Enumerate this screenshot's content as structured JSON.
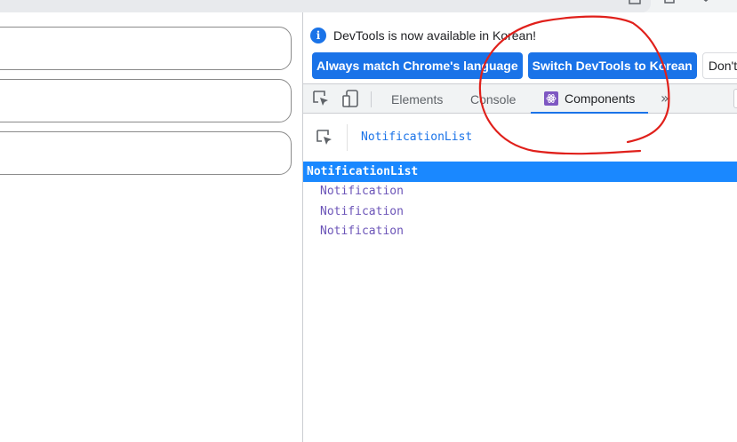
{
  "devtools": {
    "infobar": {
      "message": "DevTools is now available in Korean!",
      "buttons": {
        "match_language": "Always match Chrome's language",
        "switch_language": "Switch DevTools to Korean",
        "dont_show": "Don't"
      }
    },
    "tabs": [
      {
        "label": "Elements",
        "active": false
      },
      {
        "label": "Console",
        "active": false
      },
      {
        "label": "Components",
        "active": true
      }
    ],
    "more_tabs_symbol": "»",
    "components": {
      "breadcrumb": "NotificationList",
      "tree": {
        "root": "NotificationList",
        "children": [
          "Notification",
          "Notification",
          "Notification"
        ]
      }
    }
  },
  "colors": {
    "accent": "#1a73e8",
    "selected_row": "#1a88ff",
    "component_name": "#6c55b8",
    "annotation": "#e0201b"
  }
}
